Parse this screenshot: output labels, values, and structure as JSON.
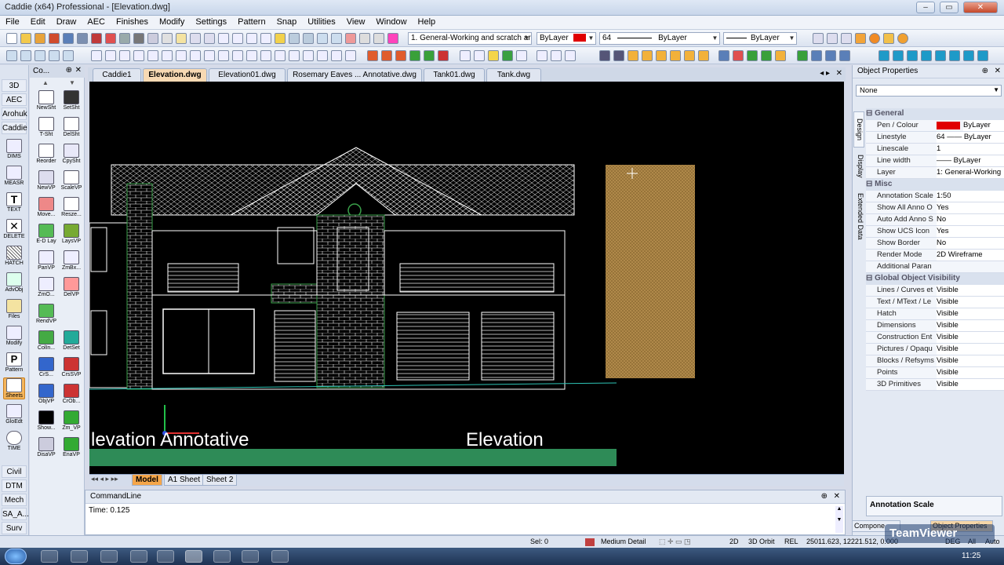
{
  "window": {
    "title": "Caddie (x64) Professional - [Elevation.dwg]",
    "controls": [
      "–",
      "▭",
      "✕"
    ]
  },
  "menu": [
    "File",
    "Edit",
    "Draw",
    "AEC",
    "Finishes",
    "Modify",
    "Settings",
    "Pattern",
    "Snap",
    "Utilities",
    "View",
    "Window",
    "Help"
  ],
  "toolbar": {
    "layer_combo": "1. General-Working and scratch ar",
    "pen_colour": "ByLayer",
    "linestyle_number": "64",
    "linestyle": "ByLayer",
    "linewidth": "ByLayer",
    "pen_colour_swatch": "#e00000"
  },
  "left_categories": {
    "top": [
      "3D",
      "AEC",
      "Arohuk",
      "Caddie"
    ],
    "bottom": [
      "Civil",
      "DTM",
      "Mech",
      "SA_A...",
      "Surv"
    ]
  },
  "left_tools": [
    "DIMS",
    "MEASR",
    "TEXT",
    "DELETE",
    "HATCH",
    "AdvObj",
    "Files",
    "Modify",
    "Pattern",
    "Sheets",
    "GloEdt",
    "TIME"
  ],
  "tool_panel": {
    "title": "Co...",
    "items": [
      "NewSht",
      "SetSht",
      "T-Sht",
      "DelSht",
      "Reorder",
      "CpySht",
      "NewVP",
      "ScaleVP",
      "Move...",
      "Resze...",
      "E-D Lay",
      "LaysVP",
      "PanVP",
      "ZmBx...",
      "ZmO...",
      "DelVP",
      "RendVP",
      "",
      "ColIn...",
      "DetSet",
      "CrS...",
      "CrsSVP",
      "ObjVP",
      "CrOb...",
      "Show...",
      "Zm_VP",
      "DisaVP",
      "EnaVP"
    ]
  },
  "doc_tabs": [
    {
      "label": "Caddie1",
      "active": false
    },
    {
      "label": "Elevation.dwg",
      "active": true
    },
    {
      "label": "Elevation01.dwg",
      "active": false
    },
    {
      "label": "Rosemary Eaves ... Annotative.dwg",
      "active": false
    },
    {
      "label": "Tank01.dwg",
      "active": false
    },
    {
      "label": "Tank.dwg",
      "active": false
    }
  ],
  "drawing": {
    "label_left": "levation Annotative",
    "label_right": "Elevation"
  },
  "sheet_tabs": [
    {
      "label": "Model",
      "active": true
    },
    {
      "label": "A1 Sheet",
      "active": false
    },
    {
      "label": "Sheet 2",
      "active": false
    }
  ],
  "commandline": {
    "title": "CommandLine",
    "output": "Time: 0.125"
  },
  "object_properties": {
    "title": "Object Properties",
    "selector": "None",
    "vertical_tabs": [
      "Design",
      "Display",
      "Extended Data"
    ],
    "sections": [
      {
        "name": "General",
        "rows": [
          {
            "key": "Pen / Colour",
            "value": "ByLayer"
          },
          {
            "key": "Linestyle",
            "value": "64 —— ByLayer"
          },
          {
            "key": "Linescale",
            "value": "1"
          },
          {
            "key": "Line width",
            "value": "—— ByLayer"
          },
          {
            "key": "Layer",
            "value": "1: General-Working"
          }
        ]
      },
      {
        "name": "Misc",
        "rows": [
          {
            "key": "Annotation Scale",
            "value": "1:50"
          },
          {
            "key": "Show All Anno O",
            "value": "Yes"
          },
          {
            "key": "Auto Add Anno S",
            "value": "No"
          },
          {
            "key": "Show UCS Icon",
            "value": "Yes"
          },
          {
            "key": "Show Border",
            "value": "No"
          },
          {
            "key": "Render Mode",
            "value": "2D Wireframe"
          },
          {
            "key": "Additional Paran",
            "value": ""
          }
        ]
      },
      {
        "name": "Global Object Visibility",
        "rows": [
          {
            "key": "Lines / Curves et",
            "value": "Visible"
          },
          {
            "key": "Text / MText / Le",
            "value": "Visible"
          },
          {
            "key": "Hatch",
            "value": "Visible"
          },
          {
            "key": "Dimensions",
            "value": "Visible"
          },
          {
            "key": "Construction Ent",
            "value": "Visible"
          },
          {
            "key": "Pictures / Opaqu",
            "value": "Visible"
          },
          {
            "key": "Blocks / Refsyms",
            "value": "Visible"
          },
          {
            "key": "Points",
            "value": "Visible"
          },
          {
            "key": "3D Primitives",
            "value": "Visible"
          }
        ]
      }
    ],
    "description_title": "Annotation Scale",
    "bottom_tabs": [
      "Compone",
      "Object Properties"
    ]
  },
  "statusbar": {
    "sel": "Sel: 0",
    "detail": "Medium Detail",
    "mode2d": "2D",
    "orbit": "3D Orbit",
    "rel": "REL",
    "coords": "25011.623, 12221.512, 0.000",
    "deg": "DEG",
    "all": "All",
    "auto": "Auto"
  },
  "taskbar": {
    "clock": "11:25",
    "watermark": "TeamViewer"
  },
  "colors": {
    "canvas": "#000000",
    "drawing_line": "#ffffff",
    "accent_green": "#2e8b57",
    "hatch_tan": "#b0894a"
  }
}
